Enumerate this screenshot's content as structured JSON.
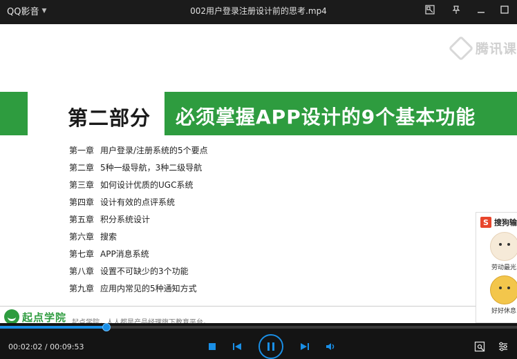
{
  "window": {
    "app_name": "QQ影音",
    "file_title": "002用户登录注册设计前的思考.mp4"
  },
  "video": {
    "watermark": "腾讯课",
    "section_title": "第二部分",
    "section_subtitle": "必须掌握APP设计的9个基本功能",
    "chapters": [
      {
        "num": "第一章",
        "title": "用户登录/注册系统的5个要点"
      },
      {
        "num": "第二章",
        "title": "5种一级导航，3种二级导航"
      },
      {
        "num": "第三章",
        "title": "如何设计优质的UGC系统"
      },
      {
        "num": "第四章",
        "title": "设计有效的点评系统"
      },
      {
        "num": "第五章",
        "title": "积分系统设计"
      },
      {
        "num": "第六章",
        "title": "搜索"
      },
      {
        "num": "第七章",
        "title": "APP消息系统"
      },
      {
        "num": "第八章",
        "title": "设置不可缺少的3个功能"
      },
      {
        "num": "第九章",
        "title": "应用内常见的5种通知方式"
      }
    ],
    "logo_text": "起点学院",
    "footer_text": "起点学院，人人都是产品经理旗下教育平台。",
    "ad": {
      "logo_letter": "S",
      "title": "搜狗输",
      "caption_1": "劳动最光",
      "caption_2": "好好休息"
    }
  },
  "player": {
    "current_time": "00:02:02",
    "total_time": "00:09:53",
    "time_separator": " / ",
    "progress": 0.206,
    "accent_color": "#1a8fe6"
  },
  "icons": {
    "mini_mode": "mini-mode-icon",
    "pin": "pin-icon",
    "minimize": "minimize-icon",
    "maximize": "maximize-icon",
    "stop": "stop-icon",
    "previous": "previous-icon",
    "pause": "pause-icon",
    "next": "next-icon",
    "volume": "volume-icon",
    "screenshot": "screenshot-icon",
    "settings": "settings-icon"
  }
}
